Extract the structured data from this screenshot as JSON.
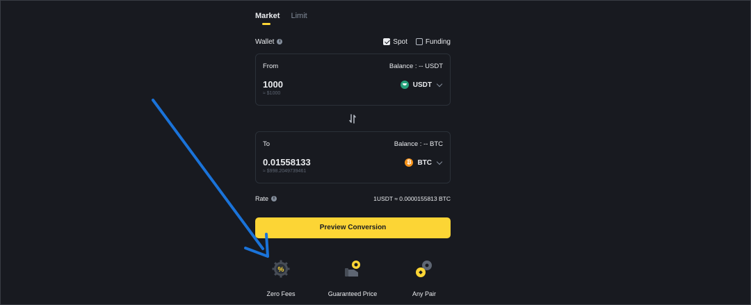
{
  "tabs": [
    {
      "label": "Market",
      "active": true
    },
    {
      "label": "Limit",
      "active": false
    }
  ],
  "wallet": {
    "label": "Wallet",
    "options": [
      {
        "label": "Spot",
        "checked": true
      },
      {
        "label": "Funding",
        "checked": false
      }
    ]
  },
  "from": {
    "label": "From",
    "balance": "Balance : -- USDT",
    "amount": "1000",
    "approx": "≈ $1000",
    "coin": "USDT"
  },
  "to": {
    "label": "To",
    "balance": "Balance : -- BTC",
    "amount": "0.01558133",
    "approx": "≈ $998.2049739461",
    "coin": "BTC"
  },
  "rate": {
    "label": "Rate",
    "value": "1USDT ≈ 0.0000155813 BTC"
  },
  "preview_button": "Preview Conversion",
  "features": [
    {
      "label": "Zero Fees",
      "icon": "percent-gear-icon"
    },
    {
      "label": "Guaranteed Price",
      "icon": "hand-coin-icon"
    },
    {
      "label": "Any Pair",
      "icon": "coins-pair-icon"
    }
  ],
  "colors": {
    "background": "#181a20",
    "accent": "#fcd535",
    "annotation_arrow": "#1a73d9"
  }
}
